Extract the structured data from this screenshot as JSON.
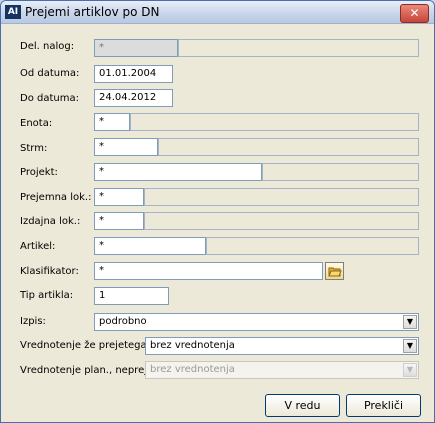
{
  "window": {
    "title": "Prejemi artiklov po DN",
    "icon_text": "AI",
    "close_glyph": "✕"
  },
  "labels": {
    "del_nalog": "Del. nalog:",
    "od_datuma": "Od datuma:",
    "do_datuma": "Do datuma:",
    "enota": "Enota:",
    "strm": "Strm:",
    "projekt": "Projekt:",
    "prejemna_lok": "Prejemna lok.:",
    "izdajna_lok": "Izdajna lok.:",
    "artikel": "Artikel:",
    "klasifikator": "Klasifikator:",
    "tip_artikla": "Tip artikla:",
    "izpis": "Izpis:",
    "vrednotenje_prejetega": "Vrednotenje že prejetega:",
    "vrednotenje_plan": "Vrednotenje plan., neprej.:"
  },
  "values": {
    "del_nalog": "*",
    "od_datuma": "01.01.2004",
    "do_datuma": "24.04.2012",
    "enota": "*",
    "strm": "*",
    "projekt": "*",
    "prejemna_lok": "*",
    "izdajna_lok": "*",
    "artikel": "*",
    "klasifikator": "*",
    "tip_artikla": "1",
    "izpis": "podrobno",
    "vrednotenje_prejetega": "brez vrednotenja",
    "vrednotenje_plan": "brez vrednotenja"
  },
  "buttons": {
    "ok": "V redu",
    "cancel": "Prekliči"
  },
  "icons": {
    "dropdown": "chevron-down-icon",
    "browse": "folder-open-icon"
  }
}
